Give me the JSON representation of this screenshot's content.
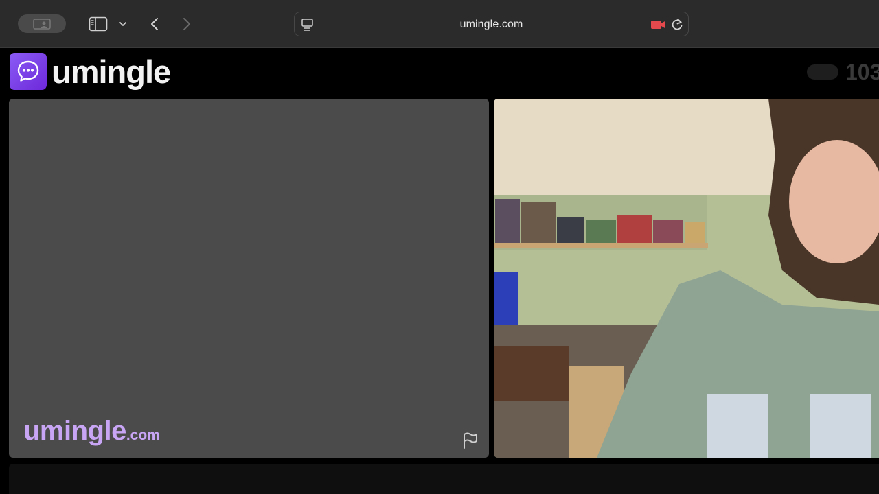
{
  "browser": {
    "url": "umingle.com",
    "icons": [
      "profile-icon",
      "sidebar-icon",
      "chevron-down-icon",
      "back-arrow-icon",
      "forward-arrow-icon",
      "page-menu-icon",
      "camera-recording-icon",
      "reload-icon"
    ],
    "colors": {
      "toolbar": "#2b2b2b",
      "camera_indicator": "#e5484d"
    }
  },
  "site": {
    "logo_text": "umingle",
    "online_count": "103",
    "watermark_main": "umingle",
    "watermark_tld": ".com",
    "colors": {
      "brand": "#7c3aed",
      "watermark": "#c9a6f5",
      "stranger_panel": "#4b4b4b"
    }
  }
}
